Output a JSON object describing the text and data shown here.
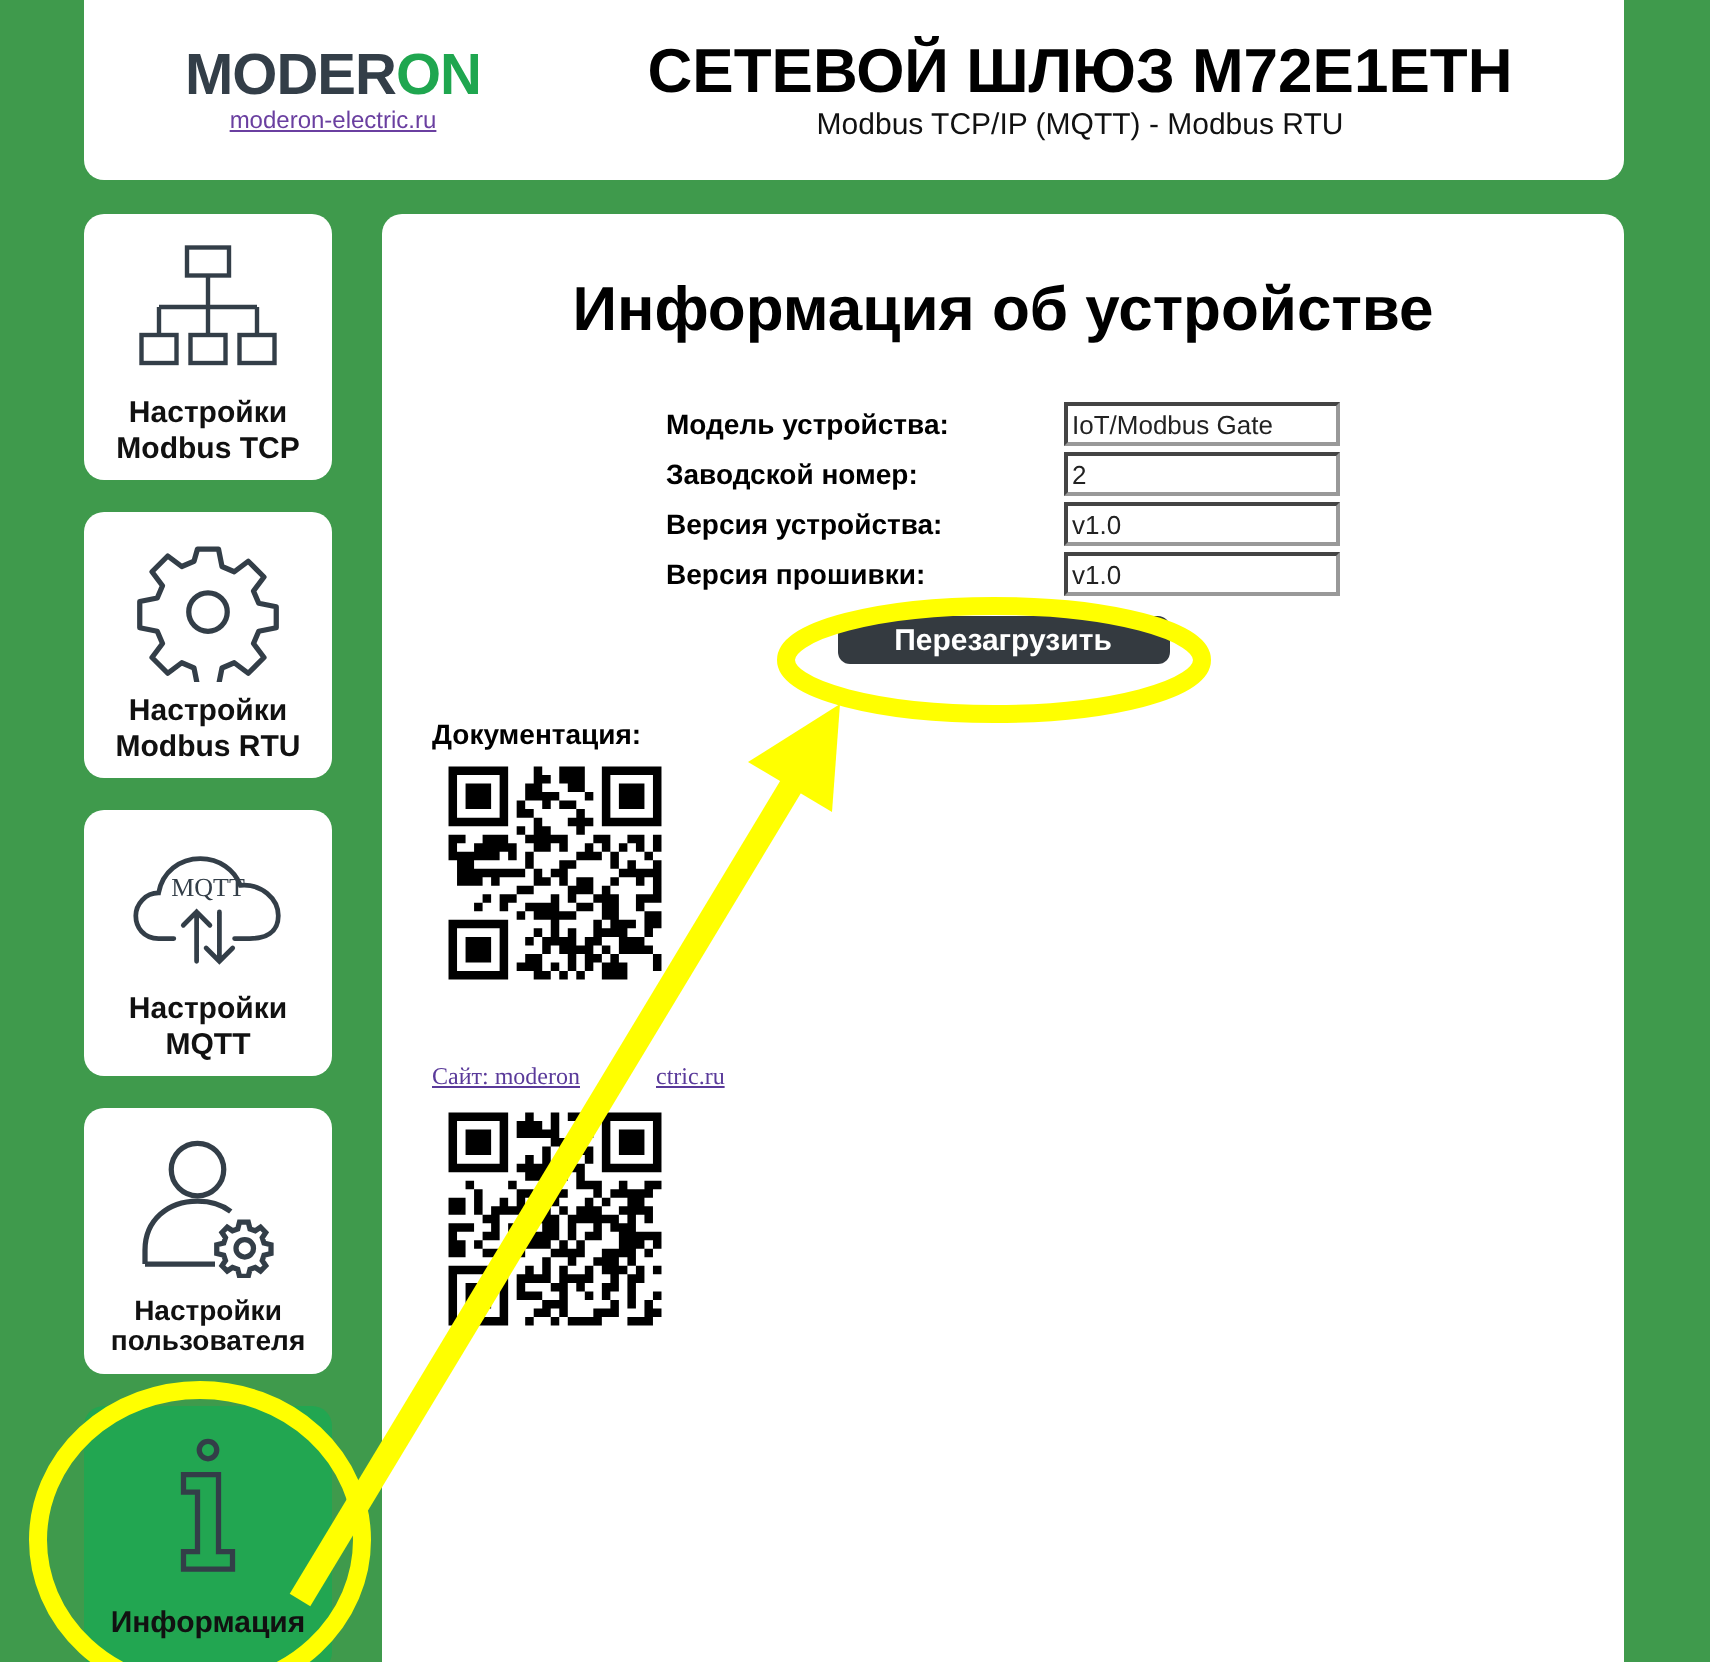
{
  "header": {
    "logo": [
      "MODER",
      "ON"
    ],
    "logo_link": "moderon-electric.ru",
    "title": "СЕТЕВОЙ ШЛЮЗ M72E1ETH",
    "subtitle": "Modbus TCP/IP (MQTT) - Modbus RTU"
  },
  "sidebar": {
    "items": [
      {
        "kind": "network",
        "label": "Настройки Modbus TCP",
        "selected": false
      },
      {
        "kind": "gear",
        "label": "Настройки Modbus RTU",
        "selected": false
      },
      {
        "kind": "cloud",
        "icon_text": "MQTT",
        "label": "Настройки MQTT",
        "selected": false
      },
      {
        "kind": "user",
        "label": "Настройки пользователя",
        "selected": false
      },
      {
        "kind": "info",
        "label": "Информация",
        "selected": true
      }
    ]
  },
  "main": {
    "title": "Информация об устройстве",
    "fields": [
      {
        "label": "Модель устройства:",
        "value": "IoT/Modbus Gate"
      },
      {
        "label": "Заводской номер:",
        "value": "2"
      },
      {
        "label": "Версия устройства:",
        "value": "v1.0"
      },
      {
        "label": "Версия прошивки:",
        "value": "v1.0"
      }
    ],
    "reboot_button": "Перезагрузить",
    "docs_label": "Документация:",
    "site_link": [
      "Сайт: moderon",
      "ctric.ru"
    ]
  }
}
